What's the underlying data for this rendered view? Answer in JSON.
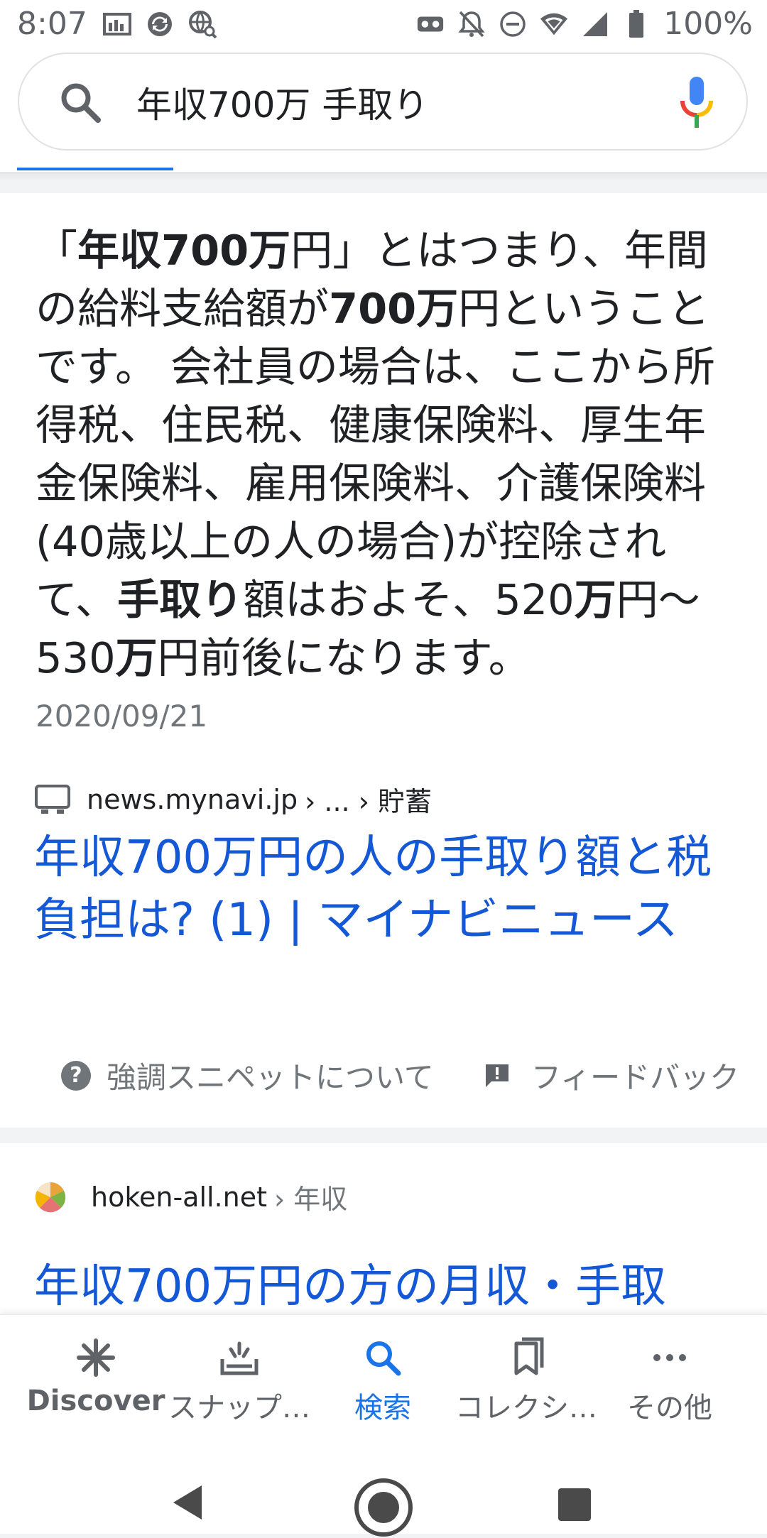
{
  "status_bar": {
    "time": "8:07",
    "battery": "100%",
    "icons_left": [
      "image-icon",
      "sync-icon",
      "globe-search-icon"
    ],
    "icons_right": [
      "vr-icon",
      "notifications-off-icon",
      "do-not-disturb-icon",
      "wifi-icon",
      "signal-icon",
      "battery-icon"
    ]
  },
  "search": {
    "query": "年収700万 手取り"
  },
  "featured": {
    "text_parts": [
      "「",
      "年収700万",
      "円」とはつまり、年間の給料支給額が",
      "700万",
      "円ということです。 会社員の場合は、ここから所得税、住民税、健康保険料、厚生年金保険料、雇用保険料、介護保険料(40歳以上の人の場合)が控除されて、",
      "手取り",
      "額はおよそ、520",
      "万",
      "円〜530",
      "万",
      "円前後になります。"
    ],
    "date": "2020/09/21",
    "source_domain": "news.mynavi.jp",
    "source_path": "› ... › 貯蓄",
    "title": "年収700万円の人の手取り額と税負担は? (1) | マイナビニュース",
    "about_label": "強調スニペットについて",
    "feedback_label": "フィードバック"
  },
  "result2": {
    "source_domain": "hoken-all.net",
    "source_path": "› 年収",
    "title": "年収700万円の方の月収・手取"
  },
  "bottom_nav": {
    "items": [
      {
        "label": "Discover",
        "icon": "asterisk-icon"
      },
      {
        "label": "スナップ…",
        "icon": "snapshot-icon"
      },
      {
        "label": "検索",
        "icon": "search-icon"
      },
      {
        "label": "コレクシ…",
        "icon": "collections-icon"
      },
      {
        "label": "その他",
        "icon": "more-icon"
      }
    ],
    "active_index": 2
  },
  "colors": {
    "accent": "#1a73e8",
    "link": "#1558d6",
    "text": "#202124",
    "secondary": "#70757a"
  }
}
